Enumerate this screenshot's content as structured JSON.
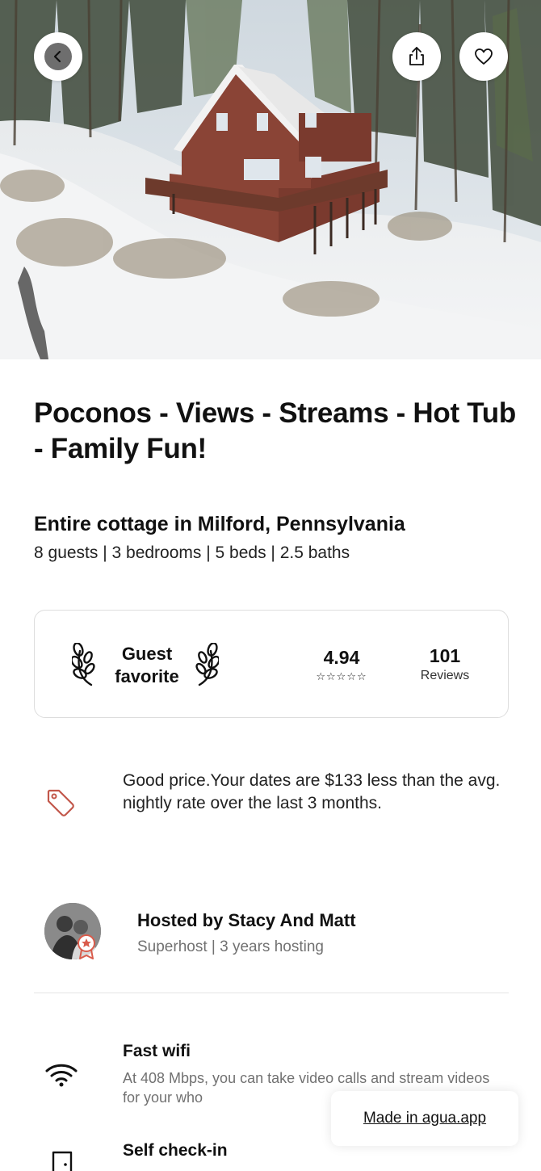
{
  "listing": {
    "title": "Poconos - Views - Streams - Hot Tub - Family Fun!",
    "subtitle": "Entire cottage in Milford, Pennsylvania",
    "details": "8 guests | 3 bedrooms | 5 beds | 2.5 baths"
  },
  "hero": {
    "icons": {
      "back": "chevron-left-icon",
      "share": "share-icon",
      "favorite": "heart-icon"
    }
  },
  "rating": {
    "badge_line1": "Guest",
    "badge_line2": "favorite",
    "score": "4.94",
    "stars_display": "☆☆☆☆☆",
    "reviews_count": "101",
    "reviews_label": "Reviews"
  },
  "price_note": {
    "text": "Good price.Your dates are $133 less than the avg. nightly rate over the last 3 months.",
    "icon": "price-tag-icon",
    "icon_color": "#c2574a"
  },
  "host": {
    "name": "Hosted by Stacy And Matt",
    "meta": "Superhost | 3 years hosting",
    "badge_color": "#d95b4b"
  },
  "amenities": [
    {
      "title": "Fast wifi",
      "description": "At 408 Mbps, you can take video calls and stream videos for your who",
      "icon": "wifi-icon"
    },
    {
      "title": "Self check-in",
      "icon": "door-icon"
    }
  ],
  "footer_badge": {
    "label": "Made in agua.app"
  }
}
